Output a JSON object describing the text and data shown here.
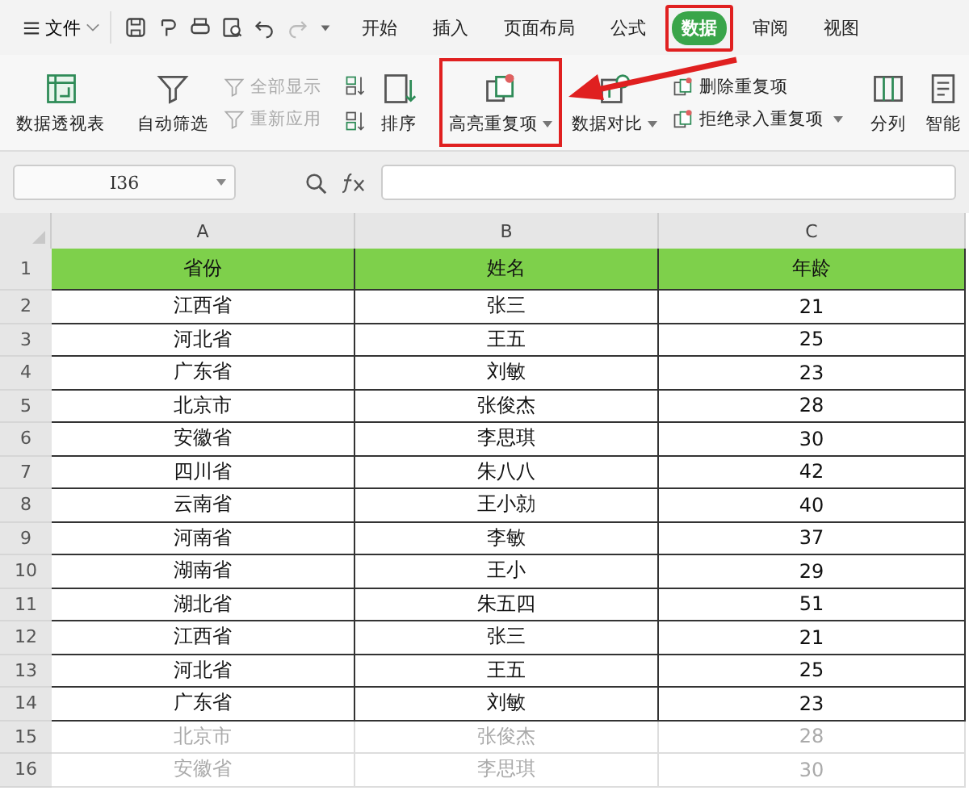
{
  "menu": {
    "label": "文件"
  },
  "tabs": [
    {
      "label": "开始",
      "selected": false,
      "highlighted": false
    },
    {
      "label": "插入",
      "selected": false,
      "highlighted": false
    },
    {
      "label": "页面布局",
      "selected": false,
      "highlighted": false
    },
    {
      "label": "公式",
      "selected": false,
      "highlighted": false
    },
    {
      "label": "数据",
      "selected": true,
      "highlighted": true
    },
    {
      "label": "审阅",
      "selected": false,
      "highlighted": false
    },
    {
      "label": "视图",
      "selected": false,
      "highlighted": false
    }
  ],
  "ribbon": [
    {
      "kind": "large",
      "label": "数据透视表",
      "dropdown": false,
      "highlighted": false
    },
    {
      "kind": "large",
      "label": "自动筛选",
      "dropdown": false,
      "highlighted": false
    },
    {
      "kind": "stack",
      "items": [
        {
          "label": "全部显示",
          "disabled": true,
          "dropdown": false
        },
        {
          "label": "重新应用",
          "disabled": true,
          "dropdown": false
        }
      ]
    },
    {
      "kind": "sortstack"
    },
    {
      "kind": "large",
      "label": "排序",
      "dropdown": false,
      "highlighted": false
    },
    {
      "kind": "large",
      "label": "高亮重复项",
      "dropdown": true,
      "highlighted": true
    },
    {
      "kind": "large",
      "label": "数据对比",
      "dropdown": true,
      "highlighted": false
    },
    {
      "kind": "stack",
      "items": [
        {
          "label": "删除重复项",
          "disabled": false,
          "dropdown": false
        },
        {
          "label": "拒绝录入重复项",
          "disabled": false,
          "dropdown": true
        }
      ]
    },
    {
      "kind": "large",
      "label": "分列",
      "dropdown": false,
      "highlighted": false
    },
    {
      "kind": "large",
      "label": "智能",
      "dropdown": false,
      "highlighted": false
    }
  ],
  "name_box": {
    "value": "I36"
  },
  "columns": [
    "A",
    "B",
    "C"
  ],
  "header_row": {
    "number": "1",
    "cells": [
      "省份",
      "姓名",
      "年龄"
    ]
  },
  "rows": [
    {
      "number": "2",
      "cells": [
        "江西省",
        "张三",
        "21"
      ],
      "faded": false
    },
    {
      "number": "3",
      "cells": [
        "河北省",
        "王五",
        "25"
      ],
      "faded": false
    },
    {
      "number": "4",
      "cells": [
        "广东省",
        "刘敏",
        "23"
      ],
      "faded": false
    },
    {
      "number": "5",
      "cells": [
        "北京市",
        "张俊杰",
        "28"
      ],
      "faded": false
    },
    {
      "number": "6",
      "cells": [
        "安徽省",
        "李思琪",
        "30"
      ],
      "faded": false
    },
    {
      "number": "7",
      "cells": [
        "四川省",
        "朱八八",
        "42"
      ],
      "faded": false
    },
    {
      "number": "8",
      "cells": [
        "云南省",
        "王小勍",
        "40"
      ],
      "faded": false
    },
    {
      "number": "9",
      "cells": [
        "河南省",
        "李敏",
        "37"
      ],
      "faded": false
    },
    {
      "number": "10",
      "cells": [
        "湖南省",
        "王小",
        "29"
      ],
      "faded": false
    },
    {
      "number": "11",
      "cells": [
        "湖北省",
        "朱五四",
        "51"
      ],
      "faded": false
    },
    {
      "number": "12",
      "cells": [
        "江西省",
        "张三",
        "21"
      ],
      "faded": false
    },
    {
      "number": "13",
      "cells": [
        "河北省",
        "王五",
        "25"
      ],
      "faded": false
    },
    {
      "number": "14",
      "cells": [
        "广东省",
        "刘敏",
        "23"
      ],
      "faded": false
    },
    {
      "number": "15",
      "cells": [
        "北京市",
        "张俊杰",
        "28"
      ],
      "faded": true
    },
    {
      "number": "16",
      "cells": [
        "安徽省",
        "李思琪",
        "30"
      ],
      "faded": true
    }
  ]
}
